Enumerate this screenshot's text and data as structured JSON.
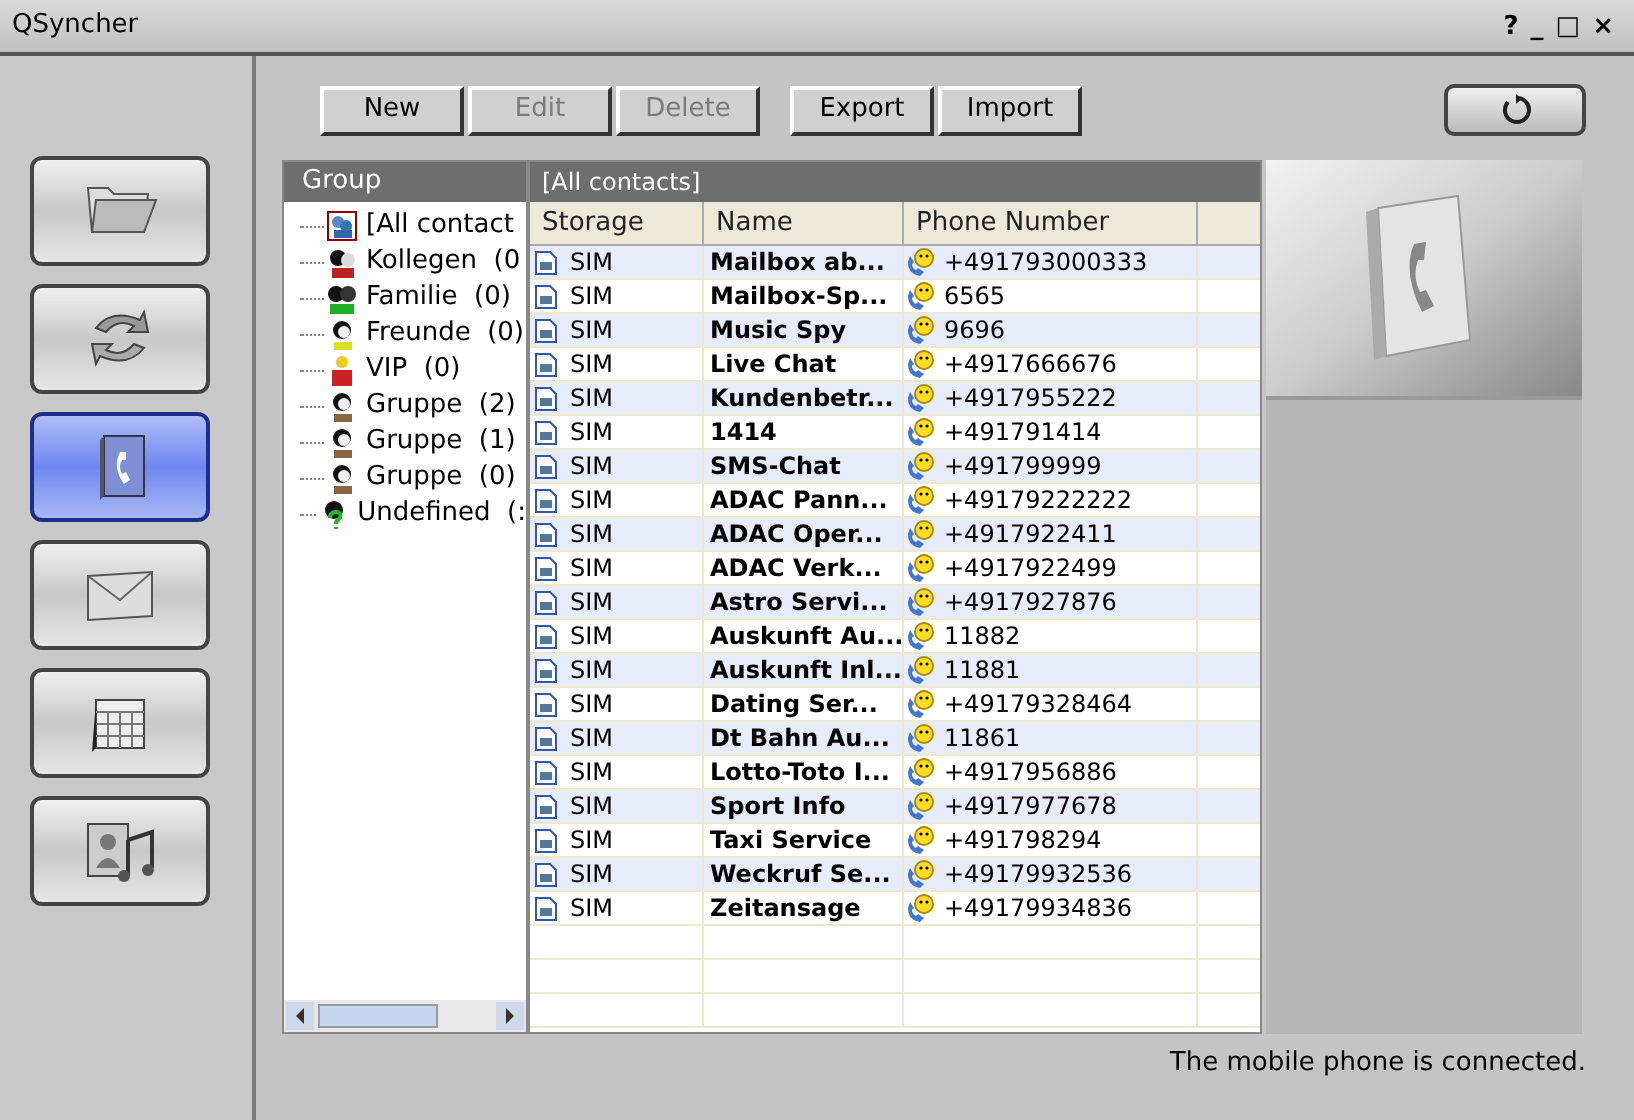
{
  "window": {
    "title": "QSyncher",
    "controls": [
      "?",
      "_",
      "□",
      "×"
    ]
  },
  "sidebar": {
    "items": [
      {
        "kind": "folder",
        "selected": false
      },
      {
        "kind": "sync",
        "selected": false
      },
      {
        "kind": "phonebook",
        "selected": true
      },
      {
        "kind": "message",
        "selected": false
      },
      {
        "kind": "calendar",
        "selected": false
      },
      {
        "kind": "media",
        "selected": false
      }
    ]
  },
  "toolbar": {
    "buttons": [
      {
        "label": "New",
        "disabled": false
      },
      {
        "label": "Edit",
        "disabled": true
      },
      {
        "label": "Delete",
        "disabled": true
      },
      {
        "label": "Export",
        "disabled": false
      },
      {
        "label": "Import",
        "disabled": false
      }
    ]
  },
  "group_panel": {
    "title": "Group",
    "items": [
      {
        "label": "[All contact",
        "kind": "all"
      },
      {
        "label": "Kollegen  (0",
        "kind": "colleagues"
      },
      {
        "label": "Familie  (0)",
        "kind": "family"
      },
      {
        "label": "Freunde  (0)",
        "kind": "friends"
      },
      {
        "label": "VIP  (0)",
        "kind": "vip"
      },
      {
        "label": "Gruppe  (2)",
        "kind": "group"
      },
      {
        "label": "Gruppe  (1)",
        "kind": "group"
      },
      {
        "label": "Gruppe  (0)",
        "kind": "group"
      },
      {
        "label": "Undefined  (:",
        "kind": "undefined"
      }
    ]
  },
  "contacts": {
    "title": "[All contacts]",
    "columns": [
      "Storage",
      "Name",
      "Phone Number"
    ],
    "rows": [
      {
        "storage": "SIM",
        "name": "Mailbox ab...",
        "phone": "+491793000333"
      },
      {
        "storage": "SIM",
        "name": "Mailbox-Sp...",
        "phone": "6565"
      },
      {
        "storage": "SIM",
        "name": "Music Spy",
        "phone": "9696"
      },
      {
        "storage": "SIM",
        "name": "Live Chat",
        "phone": "+4917666676"
      },
      {
        "storage": "SIM",
        "name": "Kundenbetr...",
        "phone": "+4917955222"
      },
      {
        "storage": "SIM",
        "name": "1414",
        "phone": "+491791414"
      },
      {
        "storage": "SIM",
        "name": "SMS-Chat",
        "phone": "+491799999"
      },
      {
        "storage": "SIM",
        "name": "ADAC Pann...",
        "phone": "+49179222222"
      },
      {
        "storage": "SIM",
        "name": "ADAC Oper...",
        "phone": "+4917922411"
      },
      {
        "storage": "SIM",
        "name": "ADAC Verk...",
        "phone": "+4917922499"
      },
      {
        "storage": "SIM",
        "name": "Astro Servi...",
        "phone": "+4917927876"
      },
      {
        "storage": "SIM",
        "name": "Auskunft Au...",
        "phone": "11882"
      },
      {
        "storage": "SIM",
        "name": "Auskunft Inl...",
        "phone": "11881"
      },
      {
        "storage": "SIM",
        "name": "Dating Ser...",
        "phone": "+49179328464"
      },
      {
        "storage": "SIM",
        "name": "Dt Bahn Au...",
        "phone": "11861"
      },
      {
        "storage": "SIM",
        "name": "Lotto-Toto I...",
        "phone": "+4917956886"
      },
      {
        "storage": "SIM",
        "name": "Sport Info",
        "phone": "+4917977678"
      },
      {
        "storage": "SIM",
        "name": "Taxi Service",
        "phone": "+491798294"
      },
      {
        "storage": "SIM",
        "name": "Weckruf Se...",
        "phone": "+49179932536"
      },
      {
        "storage": "SIM",
        "name": "Zeitansage",
        "phone": "+49179934836"
      }
    ]
  },
  "status_bar": "The mobile phone is connected."
}
